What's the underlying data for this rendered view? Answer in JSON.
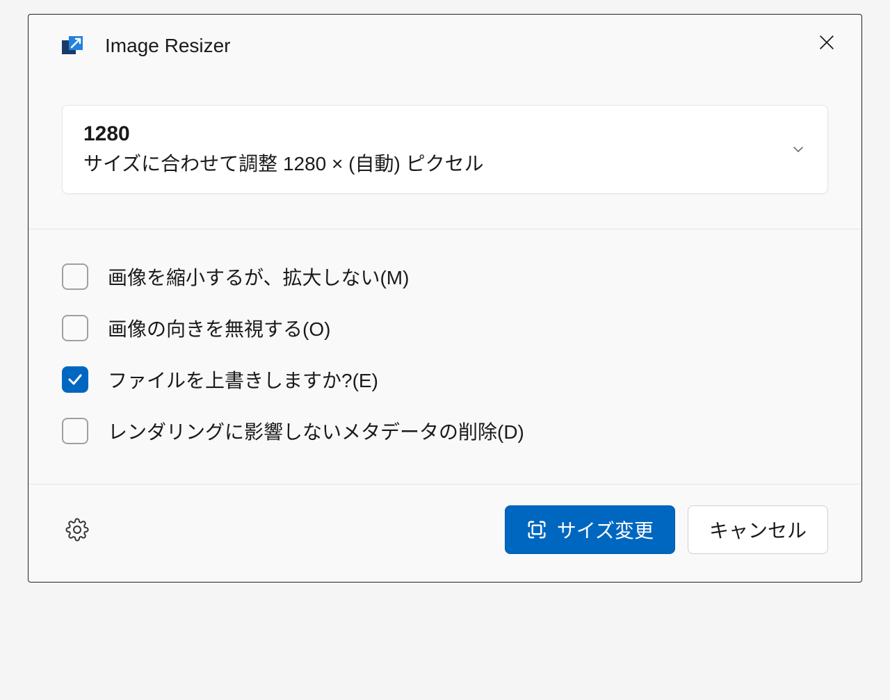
{
  "window": {
    "title": "Image Resizer"
  },
  "preset": {
    "name": "1280",
    "description": "サイズに合わせて調整 1280 × (自動) ピクセル"
  },
  "options": [
    {
      "label": "画像を縮小するが、拡大しない(M)",
      "checked": false
    },
    {
      "label": "画像の向きを無視する(O)",
      "checked": false
    },
    {
      "label": "ファイルを上書きしますか?(E)",
      "checked": true
    },
    {
      "label": "レンダリングに影響しないメタデータの削除(D)",
      "checked": false
    }
  ],
  "footer": {
    "resize_label": "サイズ変更",
    "cancel_label": "キャンセル"
  }
}
